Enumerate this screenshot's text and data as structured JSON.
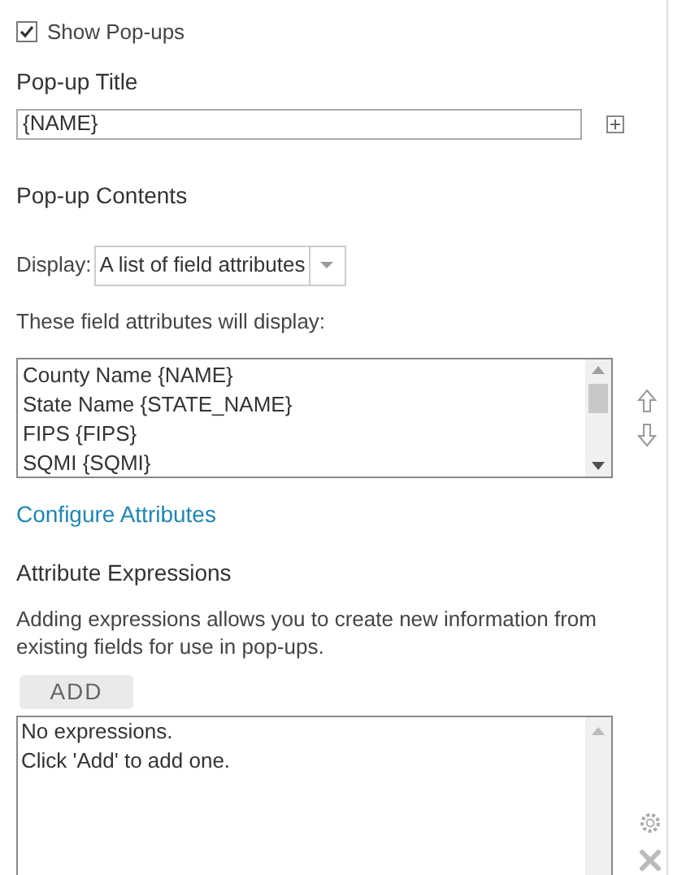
{
  "show_popups": {
    "label": "Show Pop-ups",
    "checked": true
  },
  "popup_title": {
    "heading": "Pop-up Title",
    "value": "{NAME}"
  },
  "popup_contents": {
    "heading": "Pop-up Contents",
    "display_label": "Display:",
    "display_value": "A list of field attributes",
    "list_caption": "These field attributes will display:",
    "attributes": [
      "County Name {NAME}",
      "State Name {STATE_NAME}",
      "FIPS {FIPS}",
      "SQMI {SQMI}"
    ],
    "configure_link": "Configure Attributes"
  },
  "attribute_expressions": {
    "heading": "Attribute Expressions",
    "description": "Adding expressions allows you to create new information from existing fields for use in pop-ups.",
    "add_button": "ADD",
    "empty_lines": [
      "No expressions.",
      "Click 'Add' to add one."
    ]
  }
}
